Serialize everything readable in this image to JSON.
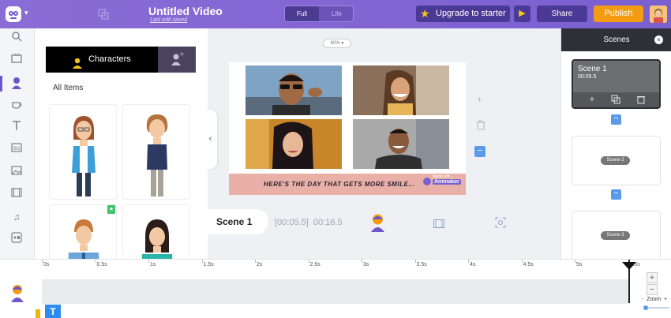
{
  "header": {
    "title": "Untitled Video",
    "subtitle": "Last edit saved",
    "mode_full": "Full",
    "mode_life": "Life",
    "upgrade_label": "Upgrade to starter",
    "share_label": "Share",
    "publish_label": "Publish"
  },
  "library": {
    "tab_characters": "Characters",
    "all_items": "All Items"
  },
  "canvas": {
    "zoom": "60%",
    "caption": "HERE'S THE DAY THAT GETS MORE SMILE...",
    "watermark_top": "Made with",
    "watermark_brand": "Animaker"
  },
  "scene_strip": {
    "label": "Scene 1",
    "start": "[00:05.5]",
    "total": "00:16.5"
  },
  "scenes_panel": {
    "title": "Scenes",
    "scene1_name": "Scene 1",
    "scene1_time": "00:05.5",
    "scene2_label": "Scene 2",
    "scene3_label": "Scene 3"
  },
  "timeline": {
    "ticks": [
      "0s",
      "0.5s",
      "1s",
      "1.5s",
      "2s",
      "2.5s",
      "3s",
      "3.5s",
      "4s",
      "4.5s",
      "5s",
      "5.5s"
    ],
    "zoom_label": "Zoom",
    "zoom_minus": "-",
    "zoom_plus": "+",
    "text_track_letter": "T"
  },
  "colors": {
    "brand": "#7a5fd0",
    "publish": "#f39c12",
    "accent_blue": "#5a9be8",
    "dark_panel": "#2f2f37"
  }
}
